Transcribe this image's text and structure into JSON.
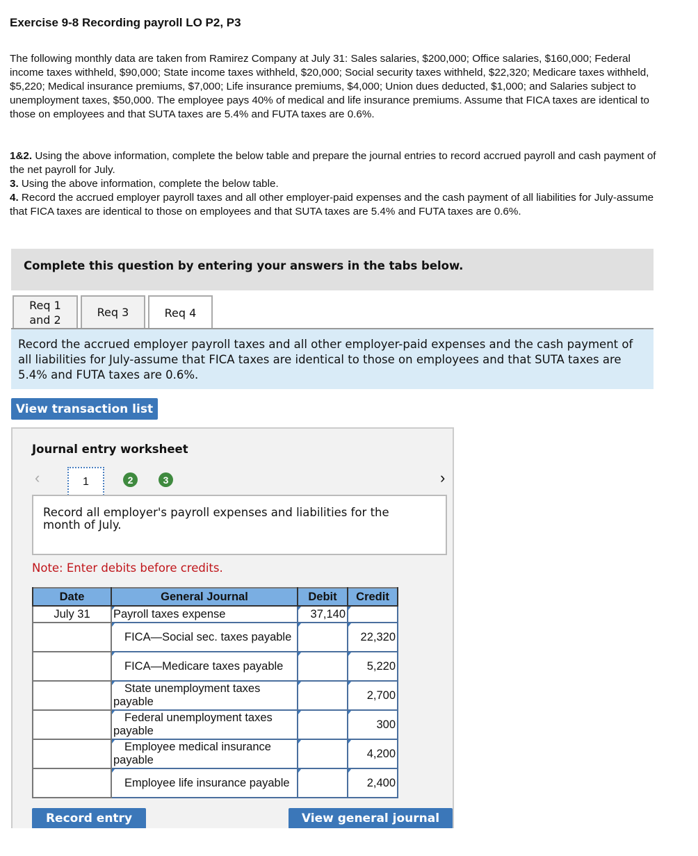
{
  "title": "Exercise 9-8 Recording payroll LO P2, P3",
  "intro": "The following monthly data are taken from Ramirez Company at July 31: Sales salaries, $200,000; Office salaries, $160,000; Federal income taxes withheld, $90,000; State income taxes withheld, $20,000; Social security taxes withheld, $22,320; Medicare taxes withheld, $5,220; Medical insurance premiums, $7,000; Life insurance premiums, $4,000; Union dues deducted, $1,000; and Salaries subject to unemployment taxes, $50,000. The employee pays 40% of medical and life insurance premiums. Assume that FICA taxes are identical to those on employees and that SUTA taxes are 5.4% and FUTA taxes are 0.6%.",
  "requirements": [
    {
      "label": "1&2.",
      "text": " Using the above information, complete the below table and prepare the journal entries to record accrued payroll and cash payment of the net payroll for July."
    },
    {
      "label": "3.",
      "text": " Using the above information, complete the below table."
    },
    {
      "label": "4.",
      "text": " Record the accrued employer payroll taxes and all other employer-paid expenses and the cash payment of all liabilities for July-assume that FICA taxes are identical to those on employees and that SUTA taxes are 5.4% and FUTA taxes are 0.6%."
    }
  ],
  "complete_banner": "Complete this question by entering your answers in the tabs below.",
  "tabs": [
    {
      "label": "Req 1 and 2",
      "active": false
    },
    {
      "label": "Req 3",
      "active": false
    },
    {
      "label": "Req 4",
      "active": true
    }
  ],
  "tab_description": "Record the accrued employer payroll taxes and all other employer-paid expenses and the cash payment of all liabilities for July-assume that FICA taxes are identical to those on employees and that SUTA taxes are 5.4% and FUTA taxes are 0.6%.",
  "view_transaction_list": "View transaction list",
  "worksheet": {
    "title": "Journal entry worksheet",
    "prev_icon": "chevron-left-icon",
    "next_icon": "chevron-right-icon",
    "steps": [
      "1",
      "2",
      "3"
    ],
    "current_step": "1",
    "step_complete_color": "#3f8a3f",
    "instruction": "Record all employer's payroll expenses and liabilities for the month of July.",
    "note": "Note: Enter debits before credits.",
    "columns": [
      "Date",
      "General Journal",
      "Debit",
      "Credit"
    ],
    "rows": [
      {
        "date": "July 31",
        "account": "Payroll taxes expense",
        "debit": "37,140",
        "credit": ""
      },
      {
        "date": "",
        "account": "FICA—Social sec. taxes payable",
        "debit": "",
        "credit": "22,320"
      },
      {
        "date": "",
        "account": "FICA—Medicare taxes payable",
        "debit": "",
        "credit": "5,220"
      },
      {
        "date": "",
        "account": "State unemployment taxes payable",
        "debit": "",
        "credit": "2,700"
      },
      {
        "date": "",
        "account": "Federal unemployment taxes payable",
        "debit": "",
        "credit": "300"
      },
      {
        "date": "",
        "account": "Employee medical insurance payable",
        "debit": "",
        "credit": "4,200"
      },
      {
        "date": "",
        "account": "Employee life insurance payable",
        "debit": "",
        "credit": "2,400"
      }
    ],
    "record_entry": "Record entry",
    "view_general_journal": "View general journal"
  },
  "colors": {
    "button": "#3b77b9",
    "header": "#7aaee2",
    "note": "#c0161b",
    "desc_bg": "#d9ebf7"
  }
}
